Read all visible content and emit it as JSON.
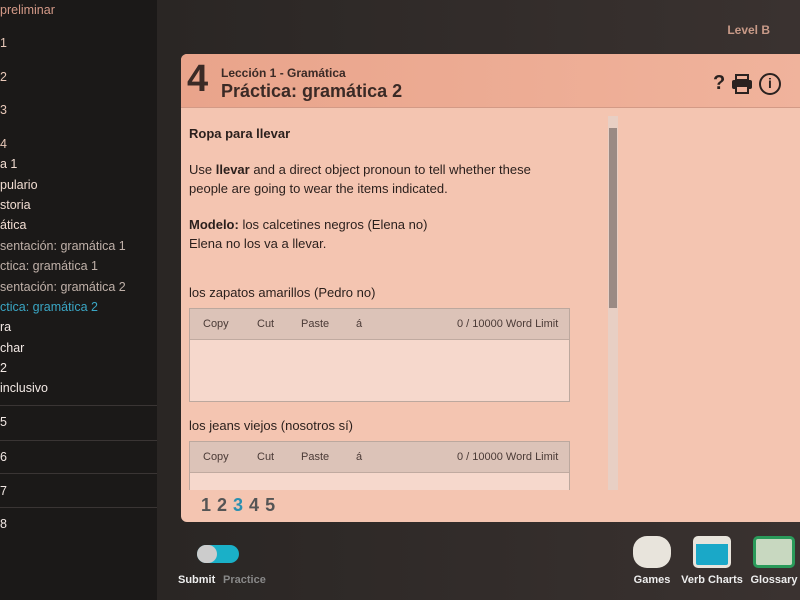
{
  "sidebar": {
    "items": [
      {
        "label": "preliminar",
        "state": "partial"
      },
      {
        "label": "1"
      },
      {
        "label": "2"
      },
      {
        "label": "3"
      },
      {
        "label": "4"
      },
      {
        "label": "a 1"
      },
      {
        "label": "pulario"
      },
      {
        "label": "storia"
      },
      {
        "label": "ática"
      },
      {
        "label": "sentación: gramática 1"
      },
      {
        "label": "ctica: gramática 1"
      },
      {
        "label": "sentación: gramática 2"
      },
      {
        "label": "ctica: gramática 2",
        "active": true
      },
      {
        "label": "ra"
      },
      {
        "label": "char"
      },
      {
        "label": " 2"
      },
      {
        "label": " inclusivo"
      },
      {
        "label": "5"
      },
      {
        "label": "6"
      },
      {
        "label": "7"
      },
      {
        "label": "8"
      }
    ]
  },
  "level": "Level B",
  "lesson": {
    "number": "4",
    "subtitle": "Lección 1 - Gramática",
    "title": "Práctica: gramática 2"
  },
  "header_icons": [
    "help-icon",
    "print-icon",
    "info-icon"
  ],
  "help": "?",
  "info": "i",
  "activity": {
    "heading": "Ropa para llevar",
    "instr_pre": "Use ",
    "instr_bold": "llevar",
    "instr_post": " and a direct object pronoun to tell whether these people are going to wear the items indicated.",
    "model_label": "Modelo:",
    "model_text": " los calcetines negros (Elena no)",
    "model_answer": "Elena no los va a llevar.",
    "items": [
      {
        "prompt": "los zapatos amarillos (Pedro no)",
        "value": ""
      },
      {
        "prompt": "los jeans viejos (nosotros sí)",
        "value": ""
      }
    ]
  },
  "editor": {
    "copy": "Copy",
    "cut": "Cut",
    "paste": "Paste",
    "accent": "á",
    "count": "0 / 10000 Word Limit"
  },
  "pager": {
    "pages": [
      "1",
      "2",
      "3",
      "4",
      "5"
    ],
    "current": "3"
  },
  "bottom": {
    "submit": "Submit",
    "practice": "Practice",
    "toggle_on": true,
    "tools": [
      "Games",
      "Verb Charts",
      "Glossary"
    ]
  }
}
